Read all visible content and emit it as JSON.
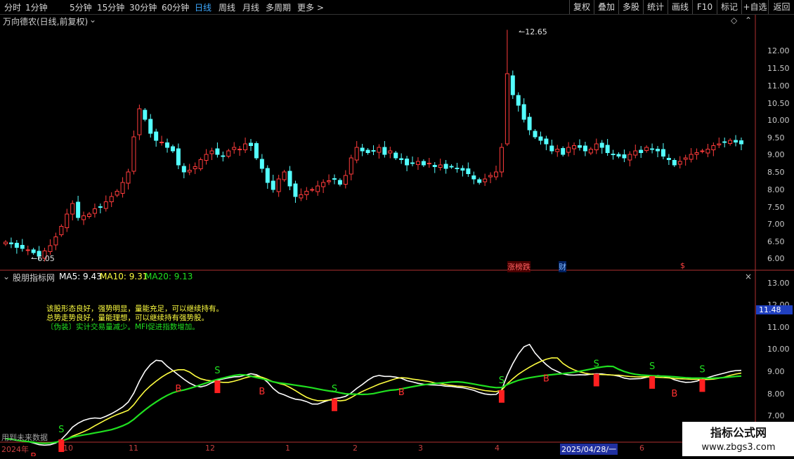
{
  "timeframes": [
    {
      "label": "分时",
      "active": false
    },
    {
      "label": "1分钟",
      "active": false
    },
    {
      "label": "5分钟",
      "active": false
    },
    {
      "label": "15分钟",
      "active": false
    },
    {
      "label": "30分钟",
      "active": false
    },
    {
      "label": "60分钟",
      "active": false
    },
    {
      "label": "日线",
      "active": true
    },
    {
      "label": "周线",
      "active": false
    },
    {
      "label": "月线",
      "active": false
    },
    {
      "label": "多周期",
      "active": false
    },
    {
      "label": "更多 >",
      "active": false
    }
  ],
  "toolbar_right": [
    "复权",
    "叠加",
    "多股",
    "统计",
    "画线",
    "F10",
    "标记",
    "+自选",
    "返回"
  ],
  "main_panel": {
    "title": "万向德农(日线,前复权)",
    "high_label": "12.65",
    "low_label": "6.05",
    "event_tags": [
      {
        "text": "涨榜跌",
        "color": "#ff4040"
      },
      {
        "text": "财",
        "color": "#4aa0ff"
      },
      {
        "text": "$",
        "color": "#ff4040"
      }
    ],
    "price_axis": [
      "12.00",
      "11.50",
      "11.00",
      "10.50",
      "10.00",
      "9.50",
      "9.00",
      "8.50",
      "8.00",
      "7.50",
      "7.00",
      "6.50",
      "6.00"
    ]
  },
  "indicator_panel": {
    "name": "股朋指标网",
    "ma5_label": "MA5: 9.43",
    "ma10_label": "MA10: 9.31",
    "ma20_label": "MA20: 9.13",
    "colors": {
      "ma5": "#ffffff",
      "ma10": "#ffff40",
      "ma20": "#20e020"
    },
    "notes": [
      {
        "text": "该股形态良好，强势明显，量能充足，可以继续持有。",
        "color": "#ffff40"
      },
      {
        "text": "总势走势良好，量能理想，可以继续持有强势股。",
        "color": "#ffff40"
      },
      {
        "text": "〔伪装〕实计交易量减少。MFI促进指数增加。",
        "color": "#20e020"
      }
    ],
    "axis": [
      "13.00",
      "12.00",
      "11.00",
      "10.00",
      "9.00",
      "8.00",
      "7.00"
    ],
    "current_value": "11.48",
    "future_data_note": "用到未来数据"
  },
  "date_axis": {
    "labels": [
      {
        "text": "2024年",
        "color": "#ff4040"
      },
      {
        "text": "10",
        "color": "#ff4040"
      },
      {
        "text": "11",
        "color": "#ff4040"
      },
      {
        "text": "12",
        "color": "#ff4040"
      },
      {
        "text": "1",
        "color": "#ff4040"
      },
      {
        "text": "2",
        "color": "#ff4040"
      },
      {
        "text": "3",
        "color": "#ff4040"
      },
      {
        "text": "4",
        "color": "#ff4040"
      },
      {
        "text": "2025/04/28/一",
        "color": "#ffffff"
      },
      {
        "text": "6",
        "color": "#ff4040"
      }
    ]
  },
  "signals": {
    "buy": "B",
    "sell": "S"
  },
  "chart_data": {
    "type": "candlestick",
    "title": "万向德农(日线,前复权)",
    "period_start": "2024-09",
    "period_end": "2025-07",
    "y_range": [
      5.9,
      12.9
    ],
    "highest": 12.65,
    "lowest": 6.05,
    "close_series": [
      6.6,
      6.55,
      6.45,
      6.42,
      6.38,
      6.3,
      6.2,
      6.35,
      6.5,
      6.75,
      7.05,
      7.4,
      7.7,
      7.3,
      7.35,
      7.4,
      7.55,
      7.6,
      7.75,
      7.9,
      8.05,
      8.3,
      8.6,
      9.6,
      10.4,
      10.1,
      9.7,
      9.5,
      9.45,
      9.3,
      9.2,
      8.8,
      8.6,
      8.65,
      8.75,
      8.95,
      9.1,
      9.2,
      9.1,
      9.05,
      9.2,
      9.3,
      9.25,
      9.4,
      9.35,
      9.0,
      8.7,
      8.3,
      8.1,
      8.4,
      8.6,
      8.2,
      7.9,
      7.95,
      8.05,
      8.1,
      8.2,
      8.3,
      8.35,
      8.4,
      8.25,
      8.5,
      9.0,
      9.3,
      9.2,
      9.15,
      9.2,
      9.3,
      9.1,
      9.2,
      9.0,
      8.95,
      8.8,
      8.85,
      8.9,
      8.8,
      8.85,
      8.75,
      8.8,
      8.7,
      8.75,
      8.7,
      8.65,
      8.55,
      8.4,
      8.3,
      8.4,
      8.5,
      8.6,
      9.3,
      11.4,
      10.8,
      10.5,
      10.1,
      9.8,
      9.6,
      9.5,
      9.4,
      9.2,
      9.25,
      9.1,
      9.3,
      9.35,
      9.3,
      9.2,
      9.25,
      9.4,
      9.3,
      9.15,
      9.1,
      9.05,
      9.0,
      9.1,
      9.2,
      9.15,
      9.3,
      9.25,
      9.2,
      9.05,
      8.95,
      8.8,
      8.9,
      9.0,
      9.1,
      9.15,
      9.2,
      9.25,
      9.35,
      9.4,
      9.45,
      9.5,
      9.45,
      9.4
    ],
    "indicator": {
      "name": "股朋指标网",
      "ma5": 9.43,
      "ma10": 9.31,
      "ma20": 9.13,
      "y_range": [
        6.6,
        13.4
      ]
    }
  }
}
